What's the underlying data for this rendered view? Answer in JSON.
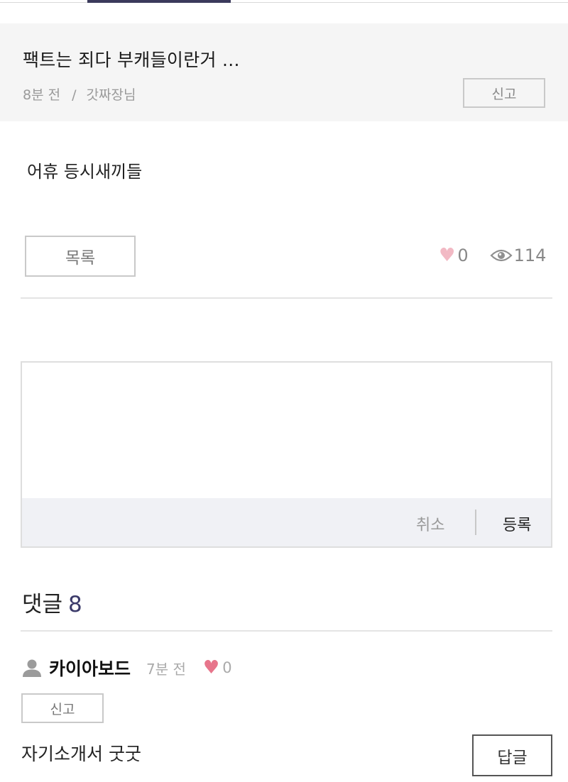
{
  "post": {
    "title": "팩트는 죄다 부캐들이란거 ...",
    "time": "8분 전",
    "separator": "/",
    "author": "갓짜장님",
    "report_label": "신고",
    "body": "어휴 등시새끼들"
  },
  "actions": {
    "list_label": "목록",
    "likes": "0",
    "views": "114"
  },
  "comment_form": {
    "placeholder": "",
    "cancel_label": "취소",
    "submit_label": "등록"
  },
  "comments": {
    "heading": "댓글",
    "count": "8",
    "items": [
      {
        "author": "카이아보드",
        "time": "7분 전",
        "likes": "0",
        "report_label": "신고",
        "text": "자기소개서 굿굿",
        "reply_label": "답글"
      }
    ]
  },
  "colors": {
    "accent": "#3b3a5c",
    "heart_light": "#f2b9c4",
    "heart": "#e7758b",
    "header_bg": "#f5f5f5",
    "action_bar_bg": "#f0f1f5"
  },
  "icons": [
    "heart-icon",
    "eye-icon",
    "user-icon"
  ]
}
